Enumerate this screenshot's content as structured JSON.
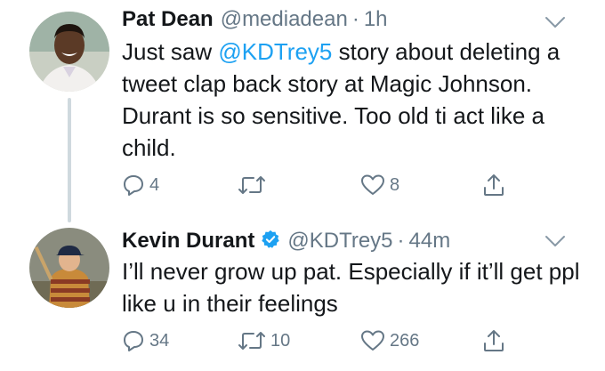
{
  "tweets": [
    {
      "name": "Pat Dean",
      "handle": "@mediadean",
      "separator": "·",
      "time": "1h",
      "verified": false,
      "text_before": "Just saw ",
      "mention": "@KDTrey5",
      "text_after": " story about deleting a tweet clap back story at Magic Johnson. Durant is so sensitive. Too old ti act like a child.",
      "replies": "4",
      "retweets": "",
      "likes": "8"
    },
    {
      "name": "Kevin Durant",
      "handle": "@KDTrey5",
      "separator": "·",
      "time": "44m",
      "verified": true,
      "text": "I’ll never grow up pat. Especially if it’ll get ppl like u in their feelings",
      "replies": "34",
      "retweets": "10",
      "likes": "266"
    }
  ],
  "icons": {
    "reply": "reply-icon",
    "retweet": "retweet-icon",
    "like": "heart-icon",
    "share": "share-icon",
    "menu": "chevron-down-icon",
    "verified": "verified-badge-icon"
  },
  "colors": {
    "text": "#14171a",
    "muted": "#657786",
    "link": "#1da1f2",
    "thread_line": "#cfd9de"
  }
}
